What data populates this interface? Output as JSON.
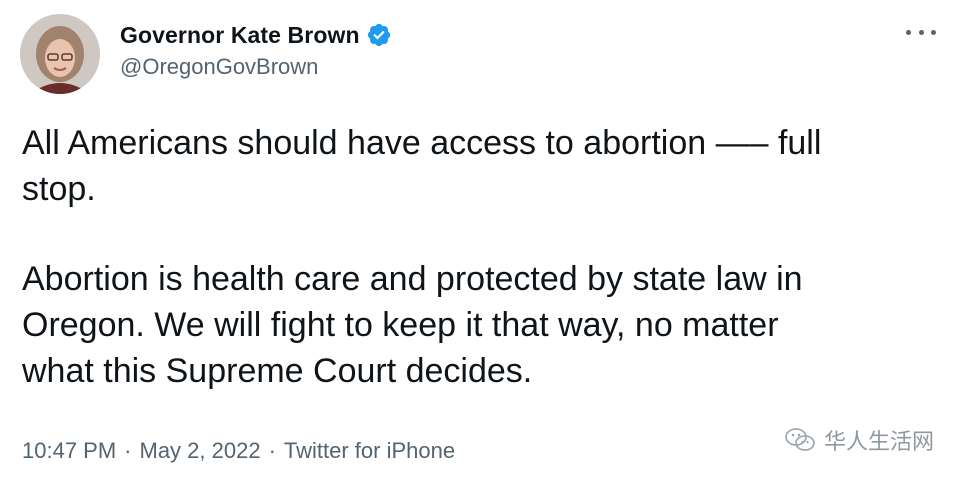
{
  "user": {
    "display_name": "Governor Kate Brown",
    "handle": "@OregonGovBrown",
    "verified_icon": "verified-badge-icon",
    "verified_color": "#1d9bf0"
  },
  "tweet": {
    "paragraphs": [
      "All Americans should have access to abortion —– full\nstop.",
      "Abortion is health care and protected by state law in\nOregon. We will fight to keep it that way, no matter\nwhat this Supreme Court decides."
    ]
  },
  "meta": {
    "time": "10:47 PM",
    "separator": "·",
    "date": "May 2, 2022",
    "source": "Twitter for iPhone"
  },
  "more_icon": "more-horizontal-icon",
  "watermark": {
    "text": "华人生活网"
  }
}
